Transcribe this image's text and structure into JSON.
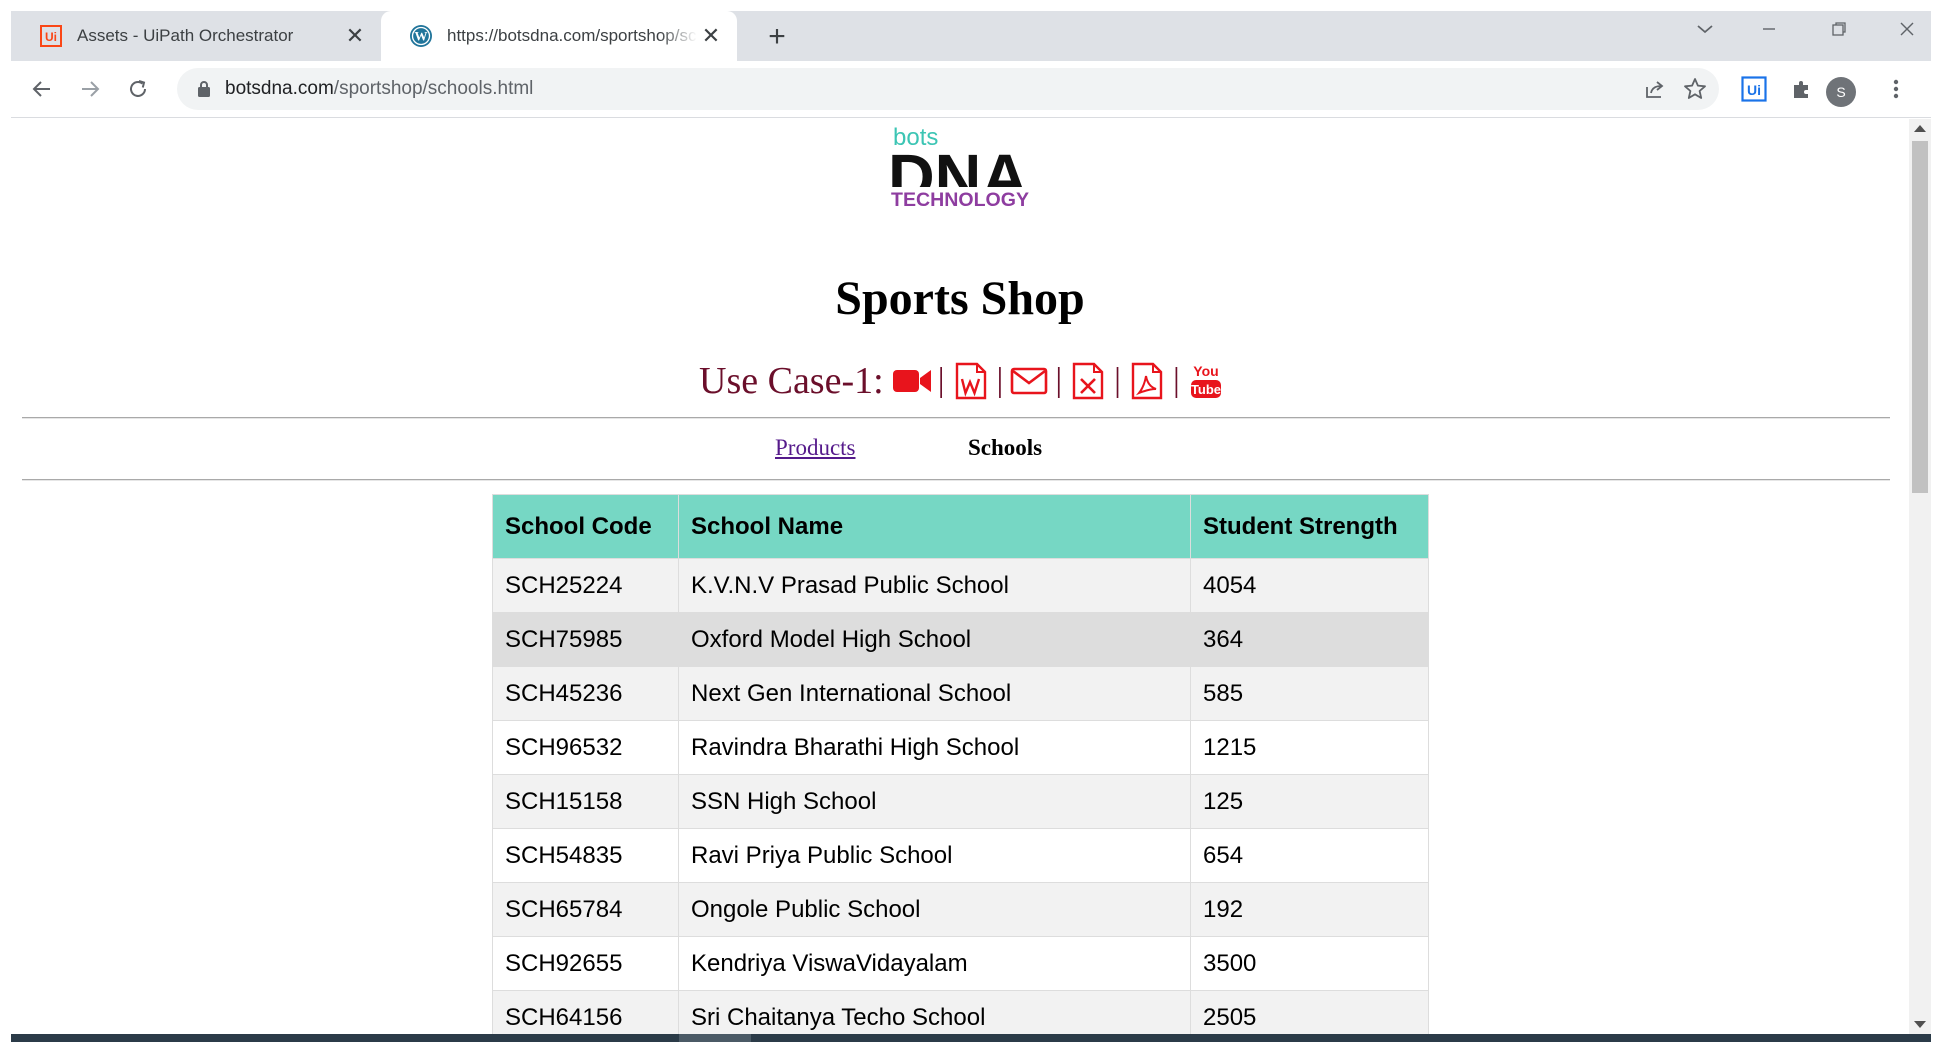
{
  "browser": {
    "tabs": [
      {
        "title": "Assets - UiPath Orchestrator",
        "favicon": "uipath-icon",
        "active": false
      },
      {
        "title": "https://botsdna.com/sportshop/schools.html",
        "favicon": "wordpress-icon",
        "active": true
      }
    ],
    "url_host": "botsdna.com",
    "url_path": "/sportshop/schools.html",
    "profile_initial": "S",
    "extension_label": "Ui"
  },
  "page": {
    "logo": {
      "top": "bots",
      "main": "DNA",
      "sub": "TECHNOLOGY"
    },
    "title": "Sports Shop",
    "use_case_label": "Use Case-1:",
    "use_case_icons": [
      "video-camera-icon",
      "word-document-icon",
      "envelope-icon",
      "excel-document-icon",
      "pdf-document-icon",
      "youtube-icon"
    ],
    "youtube_top": "You",
    "youtube_bottom": "Tube",
    "nav": {
      "products": "Products",
      "schools": "Schools"
    },
    "colors": {
      "header_bg": "#76d7c4",
      "icon_red": "#e8141c",
      "use_case_text": "#6b0f2b",
      "visited_link": "#551a8b"
    }
  },
  "table": {
    "headers": [
      "School Code",
      "School Name",
      "Student Strength"
    ],
    "rows": [
      [
        "SCH25224",
        "K.V.N.V Prasad Public School",
        "4054"
      ],
      [
        "SCH75985",
        "Oxford Model High School",
        "364"
      ],
      [
        "SCH45236",
        "Next Gen International School",
        "585"
      ],
      [
        "SCH96532",
        "Ravindra Bharathi High School",
        "1215"
      ],
      [
        "SCH15158",
        "SSN High School",
        "125"
      ],
      [
        "SCH54835",
        "Ravi Priya Public School",
        "654"
      ],
      [
        "SCH65784",
        "Ongole Public School",
        "192"
      ],
      [
        "SCH92655",
        "Kendriya ViswaVidayalam",
        "3500"
      ],
      [
        "SCH64156",
        "Sri Chaitanya Techo School",
        "2505"
      ]
    ]
  }
}
